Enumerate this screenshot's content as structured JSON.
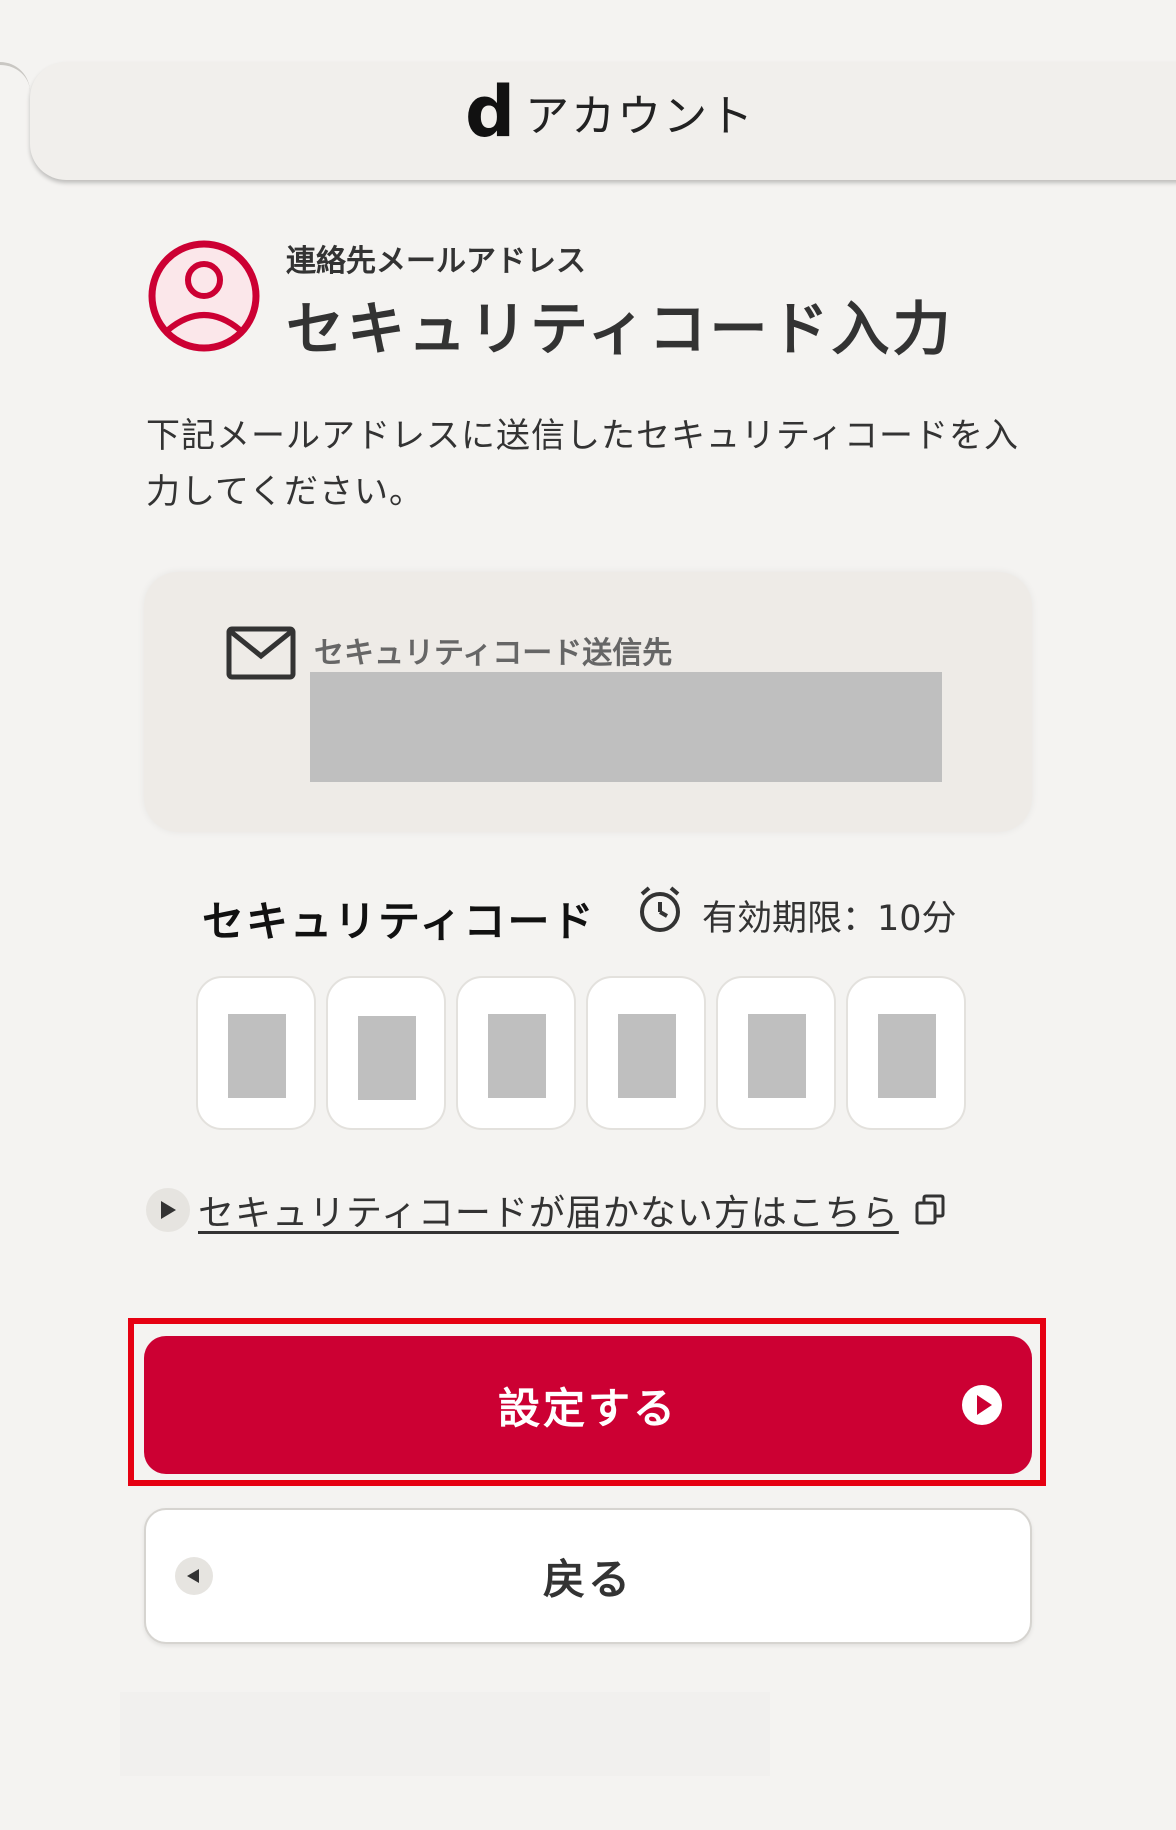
{
  "header": {
    "brand_mark": "d",
    "brand_text": "アカウント"
  },
  "title": {
    "subtitle": "連絡先メールアドレス",
    "main": "セキュリティコード入力"
  },
  "description": "下記メールアドレスに送信したセキュリティコードを入力してください。",
  "email_card": {
    "label": "セキュリティコード送信先",
    "value": ""
  },
  "security_code": {
    "label": "セキュリティコード",
    "validity": "有効期限：10分",
    "digits": [
      "",
      "",
      "",
      "",
      "",
      ""
    ]
  },
  "help_link": "セキュリティコードが届かない方はこちら",
  "buttons": {
    "submit": "設定する",
    "back": "戻る"
  },
  "colors": {
    "accent": "#cc0033",
    "highlight": "#e60012",
    "background": "#f4f3f1"
  }
}
